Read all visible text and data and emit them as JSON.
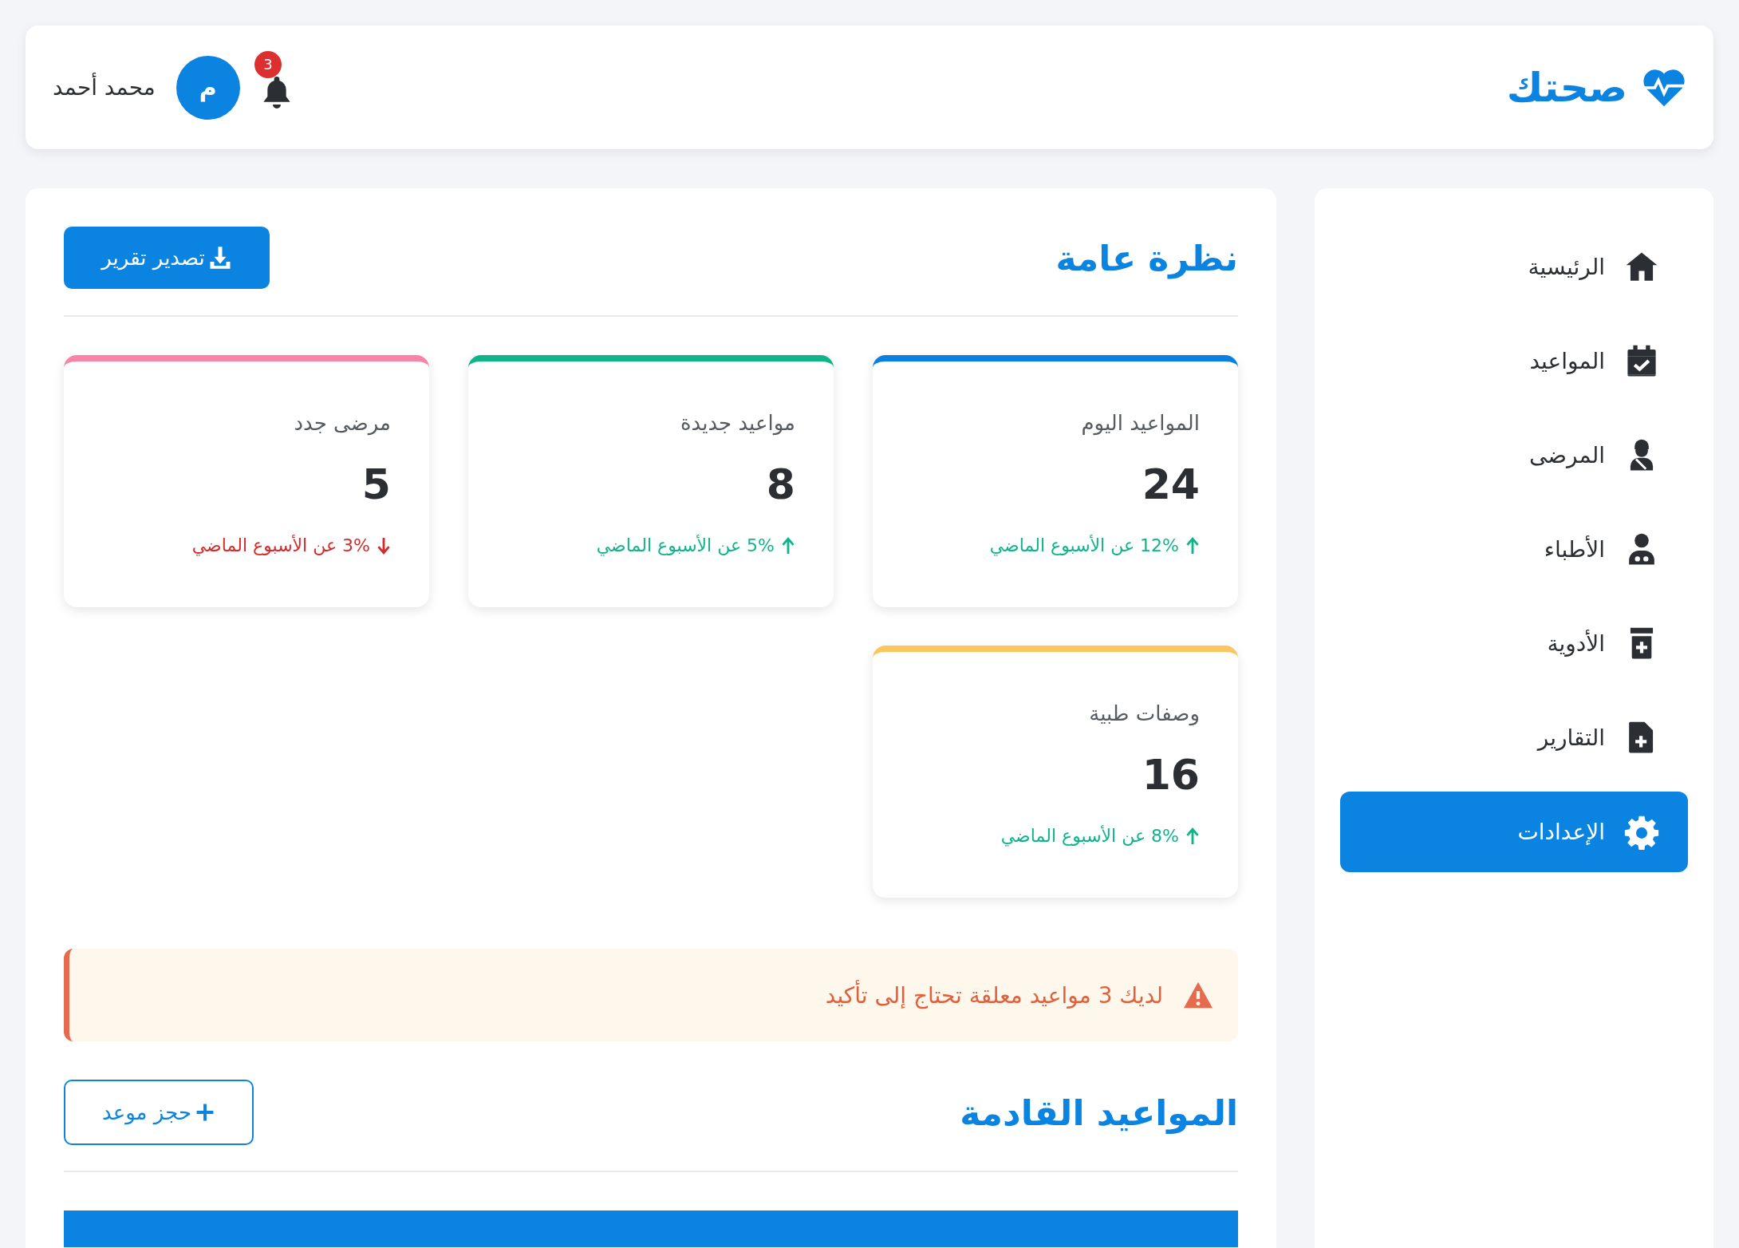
{
  "header": {
    "logo": "صحتك",
    "notifications": "3",
    "avatar": "م",
    "user_name": "محمد أحمد"
  },
  "sidebar": {
    "items": [
      {
        "label": "الرئيسية",
        "selected": false
      },
      {
        "label": "المواعيد",
        "selected": false
      },
      {
        "label": "المرضى",
        "selected": false
      },
      {
        "label": "الأطباء",
        "selected": false
      },
      {
        "label": "الأدوية",
        "selected": false
      },
      {
        "label": "التقارير",
        "selected": false
      },
      {
        "label": "الإعدادات",
        "selected": true
      }
    ]
  },
  "overview": {
    "title": "نظرة عامة",
    "export_button": "تصدير تقرير",
    "stats": [
      {
        "label": "المواعيد اليوم",
        "value": "24",
        "change": "12% عن الأسبوع الماضي",
        "kind": "up",
        "color": "#0a7fe0"
      },
      {
        "label": "مواعيد جديدة",
        "value": "8",
        "change": "5% عن الأسبوع الماضي",
        "kind": "up",
        "color": "#10b48a"
      },
      {
        "label": "مرضى جدد",
        "value": "5",
        "change": "3% عن الأسبوع الماضي",
        "kind": "down",
        "color": "#f783a6"
      },
      {
        "label": "وصفات طبية",
        "value": "16",
        "change": "8% عن الأسبوع الماضي",
        "kind": "up",
        "color": "#fbc560"
      }
    ],
    "alert": "لديك 3 مواعيد معلقة تحتاج إلى تأكيد"
  },
  "upcoming": {
    "title": "المواعيد القادمة",
    "book_button": "حجز موعد"
  }
}
